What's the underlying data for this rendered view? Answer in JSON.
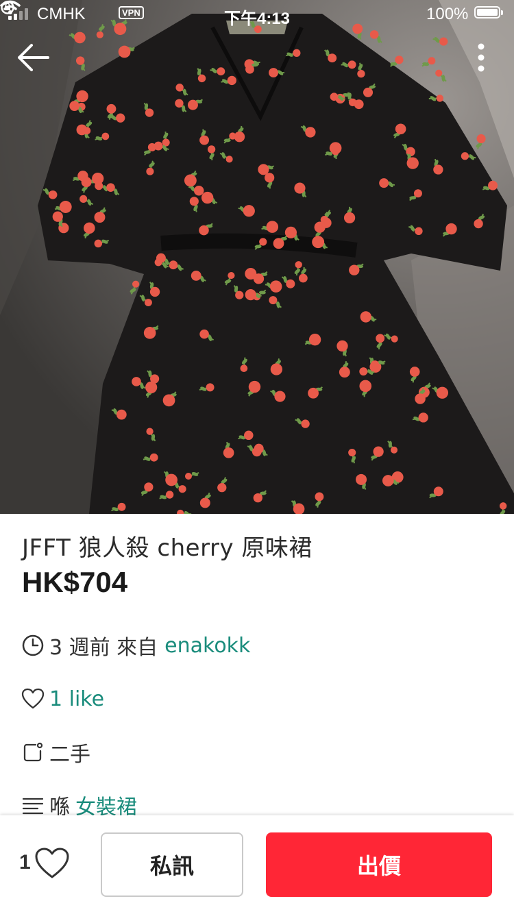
{
  "status_bar": {
    "carrier": "CMHK",
    "vpn": "VPN",
    "time": "下午4:13",
    "battery": "100%"
  },
  "listing": {
    "title": "JFFT 狼人殺 cherry 原味裙",
    "price": "HK$704",
    "posted_ago": "3 週前 來自",
    "seller": "enakokk",
    "likes_text": "1 like",
    "condition": "二手",
    "category_prefix": "喺",
    "category": "女裝裙"
  },
  "bottom_bar": {
    "like_count": "1",
    "chat_label": "私訊",
    "offer_label": "出價"
  },
  "icons": {
    "back": "back-arrow-icon",
    "more": "more-vertical-icon",
    "clock": "clock-icon",
    "heart": "heart-icon",
    "tag": "tag-icon",
    "list": "list-icon"
  },
  "colors": {
    "accent_link": "#1a8c7c",
    "offer_button": "#ff2636",
    "dress": "#1c1a1a",
    "flower": "#e85a4a",
    "leaf": "#6f9a4a"
  }
}
